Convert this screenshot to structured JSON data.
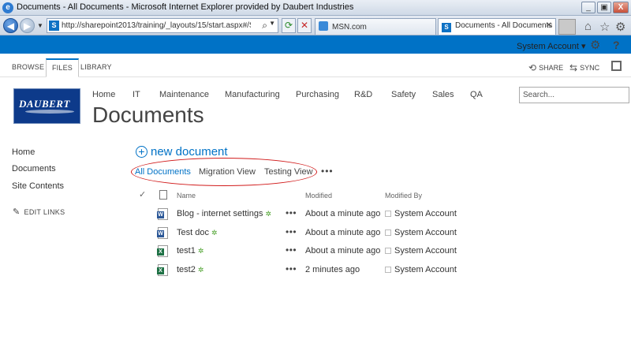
{
  "window": {
    "title": "Documents - All Documents - Microsoft Internet Explorer provided by Daubert Industries",
    "minimize": "_",
    "maximize": "▣",
    "close": "X"
  },
  "browser": {
    "url": "http://sharepoint2013/training/_layouts/15/start.aspx#/Shared%",
    "tabs": [
      {
        "label": "MSN.com",
        "active": false
      },
      {
        "label": "Documents - All Documents",
        "active": true
      }
    ]
  },
  "suite": {
    "user": "System Account",
    "user_caret": "▾",
    "help": "?"
  },
  "ribbon": {
    "tabs": [
      "BROWSE",
      "FILES",
      "LIBRARY"
    ],
    "share": "SHARE",
    "sync": "SYNC"
  },
  "site": {
    "logo_text": "DAUBERT",
    "top_nav": [
      "Home",
      "IT",
      "Maintenance",
      "Manufacturing",
      "Purchasing",
      "R&D",
      "Safety",
      "Sales",
      "QA"
    ],
    "page_title": "Documents",
    "search_placeholder": "Search..."
  },
  "left_nav": {
    "items": [
      "Home",
      "Documents",
      "Site Contents"
    ],
    "edit_links": "EDIT LINKS"
  },
  "library": {
    "new_document": "new document",
    "views": [
      "All Documents",
      "Migration View",
      "Testing View"
    ],
    "views_more": "•••",
    "columns": {
      "name": "Name",
      "modified": "Modified",
      "modified_by": "Modified By"
    },
    "rows": [
      {
        "name": "Blog - internet settings",
        "type": "word",
        "modified": "About a minute ago",
        "modified_by": "System Account"
      },
      {
        "name": "Test doc",
        "type": "word",
        "modified": "About a minute ago",
        "modified_by": "System Account"
      },
      {
        "name": "test1",
        "type": "excel",
        "modified": "About a minute ago",
        "modified_by": "System Account"
      },
      {
        "name": "test2",
        "type": "excel",
        "modified": "2 minutes ago",
        "modified_by": "System Account"
      }
    ],
    "row_menu": "•••",
    "new_marker": "✲"
  },
  "colors": {
    "accent": "#0072c6",
    "annotation": "#d11a1a"
  }
}
